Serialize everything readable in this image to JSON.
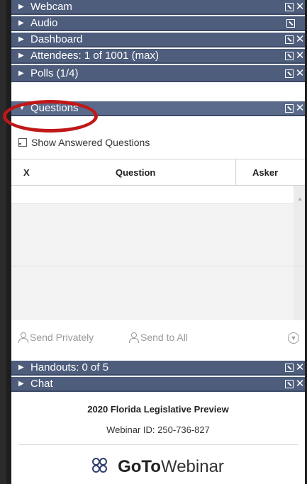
{
  "panels": {
    "webcam": "Webcam",
    "audio": "Audio",
    "dashboard": "Dashboard",
    "attendees": "Attendees: 1 of 1001 (max)",
    "polls": "Polls (1/4)",
    "questions": "Questions",
    "handouts": "Handouts: 0 of 5",
    "chat": "Chat"
  },
  "icons": {
    "expand_collapsed": "▶",
    "expand_open": "▼",
    "close": "✕"
  },
  "questions": {
    "show_answered": "Show Answered Questions",
    "columns": [
      "X",
      "Question",
      "Asker"
    ],
    "send_privately": "Send Privately",
    "send_to_all": "Send to All"
  },
  "footer": {
    "title": "2020 Florida Legislative Preview",
    "webinar_id": "Webinar ID: 250-736-827",
    "brand_goto": "GoTo",
    "brand_webinar": "Webinar"
  },
  "colors": {
    "panel_bar": "#4e5d7c",
    "highlight_circle": "#c01818"
  }
}
